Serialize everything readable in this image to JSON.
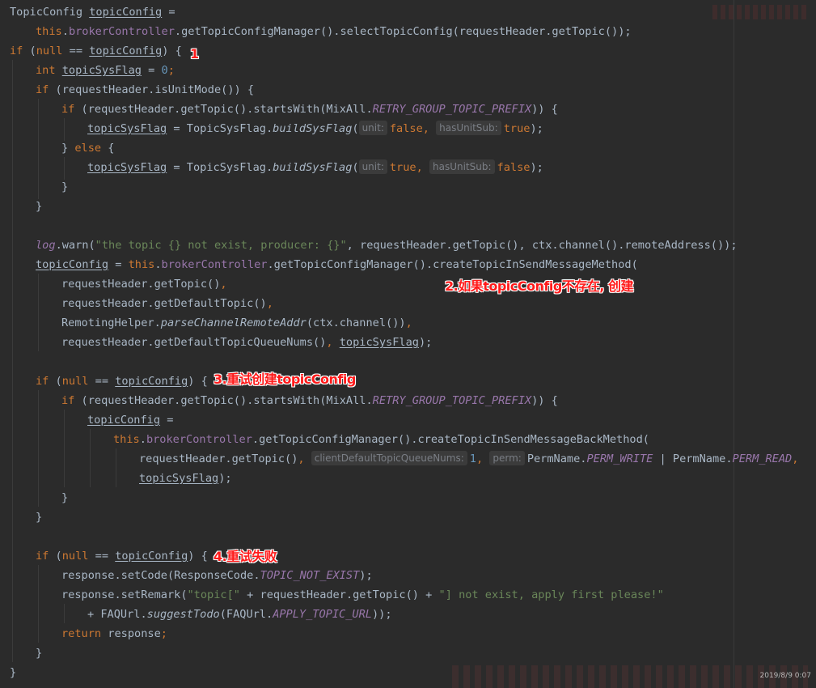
{
  "annotations": {
    "a1": "1",
    "a2": "2.如果topicConfig不存在, 创建",
    "a3": "3.重试创建topicConfig",
    "a4": "4.重试失败"
  },
  "watermark": "2019/8/9 0:07",
  "colors": {
    "background": "#2b2b2b",
    "default_text": "#a9b7c6",
    "keyword": "#cc7832",
    "field": "#9876aa",
    "number": "#6897bb",
    "string": "#6a8759",
    "annotation": "#ff1a1a"
  },
  "code": {
    "l1": "TopicConfig ",
    "l1_var": "topicConfig",
    "l1_b": " =",
    "l2_this": "this",
    "l2_dot": ".",
    "l2_fld": "brokerController",
    "l2_b": ".getTopicConfigManager().selectTopicConfig(requestHeader.getTopic());",
    "l3_if": "if",
    "l3_a": " (",
    "l3_null": "null",
    "l3_b": " == ",
    "l3_var": "topicConfig",
    "l3_c": ") {",
    "l4_int": "int",
    "l4_a": " ",
    "l4_var": "topicSysFlag",
    "l4_b": " = ",
    "l4_num": "0",
    "l4_semi": ";",
    "l5_if": "if",
    "l5_b": " (requestHeader.isUnitMode()) {",
    "l6_if": "if",
    "l6_b": " (requestHeader.getTopic().startsWith(MixAll.",
    "l6_st": "RETRY_GROUP_TOPIC_PREFIX",
    "l6_c": ")) {",
    "l7_var": "topicSysFlag",
    "l7_b": " = TopicSysFlag.",
    "l7_fn": "buildSysFlag",
    "l7_c": "(",
    "l7_h1": "unit:",
    "l7_v1": "false",
    "l7_d": ", ",
    "l7_h2": "hasUnitSub:",
    "l7_v2": "true",
    "l7_e": ");",
    "l8_a": "} ",
    "l8_else": "else",
    "l8_b": " {",
    "l9_var": "topicSysFlag",
    "l9_b": " = TopicSysFlag.",
    "l9_fn": "buildSysFlag",
    "l9_c": "(",
    "l9_h1": "unit:",
    "l9_v1": "true",
    "l9_d": ", ",
    "l9_h2": "hasUnitSub:",
    "l9_v2": "false",
    "l9_e": ");",
    "l10": "}",
    "l11": "}",
    "l13_fld": "log",
    "l13_a": ".warn(",
    "l13_str": "\"the topic {} not exist, producer: {}\"",
    "l13_b": ", requestHeader.getTopic(), ctx.channel().remoteAddress());",
    "l14_var": "topicConfig",
    "l14_a": " = ",
    "l14_this": "this",
    "l14_dot": ".",
    "l14_fld": "brokerController",
    "l14_b": ".getTopicConfigManager().createTopicInSendMessageMethod(",
    "l15_a": "requestHeader.getTopic()",
    "l15_c": ",",
    "l16_a": "requestHeader.getDefaultTopic()",
    "l16_c": ",",
    "l17_a": "RemotingHelper.",
    "l17_fn": "parseChannelRemoteAddr",
    "l17_b": "(ctx.channel())",
    "l17_c": ",",
    "l18_a": "requestHeader.getDefaultTopicQueueNums()",
    "l18_c": ", ",
    "l18_var": "topicSysFlag",
    "l18_d": ");",
    "l20_if": "if",
    "l20_a": " (",
    "l20_null": "null",
    "l20_b": " == ",
    "l20_var": "topicConfig",
    "l20_c": ") {",
    "l21_if": "if",
    "l21_b": " (requestHeader.getTopic().startsWith(MixAll.",
    "l21_st": "RETRY_GROUP_TOPIC_PREFIX",
    "l21_c": ")) {",
    "l22_var": "topicConfig",
    "l22_b": " =",
    "l23_this": "this",
    "l23_dot": ".",
    "l23_fld": "brokerController",
    "l23_b": ".getTopicConfigManager().createTopicInSendMessageBackMethod(",
    "l24_a": "requestHeader.getTopic()",
    "l24_c": ", ",
    "l24_h1": "clientDefaultTopicQueueNums:",
    "l24_num": "1",
    "l24_d": ", ",
    "l24_h2": "perm:",
    "l24_e": "PermName.",
    "l24_st1": "PERM_WRITE",
    "l24_f": " | PermName.",
    "l24_st2": "PERM_READ",
    "l24_g": ",",
    "l25_var": "topicSysFlag",
    "l25_b": ");",
    "l26": "}",
    "l27": "}",
    "l29_if": "if",
    "l29_a": " (",
    "l29_null": "null",
    "l29_b": " == ",
    "l29_var": "topicConfig",
    "l29_c": ") {",
    "l30_a": "response.setCode(ResponseCode.",
    "l30_st": "TOPIC_NOT_EXIST",
    "l30_b": ");",
    "l31_a": "response.setRemark(",
    "l31_s1": "\"topic[\"",
    "l31_b": " + requestHeader.getTopic() + ",
    "l31_s2": "\"] not exist, apply first please!\"",
    "l32_a": "+ FAQUrl.",
    "l32_fn": "suggestTodo",
    "l32_b": "(FAQUrl.",
    "l32_st": "APPLY_TOPIC_URL",
    "l32_c": "));",
    "l33_ret": "return",
    "l33_a": " response",
    "l33_semi": ";",
    "l34": "}",
    "l35": "}"
  }
}
